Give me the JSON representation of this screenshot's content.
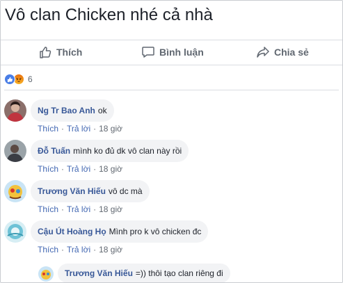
{
  "post": {
    "text": "Vô clan Chicken nhé cả nhà"
  },
  "actions": {
    "like": "Thích",
    "comment": "Bình luận",
    "share": "Chia sẻ"
  },
  "reactions": {
    "count": "6",
    "types": [
      "like-icon",
      "angry-icon"
    ]
  },
  "comments": [
    {
      "author": "Ng Tr Bao Anh",
      "text": "ok",
      "like": "Thích",
      "reply": "Trả lời",
      "time": "18 giờ"
    },
    {
      "author": "Đỗ Tuấn",
      "text": "mình ko đủ dk vô clan này rồi",
      "like": "Thích",
      "reply": "Trả lời",
      "time": "18 giờ"
    },
    {
      "author": "Trương Văn Hiếu",
      "text": "vô dc mà",
      "like": "Thích",
      "reply": "Trả lời",
      "time": "18 giờ"
    },
    {
      "author": "Cậu Út Hoàng Họ",
      "text": "Mình pro k vô chicken đc",
      "like": "Thích",
      "reply": "Trả lời",
      "time": "18 giờ"
    }
  ],
  "reply": {
    "author": "Trương Văn Hiếu",
    "text": "=)) thôi tạo clan riêng đi"
  },
  "colors": {
    "link": "#385898",
    "meta_link": "#4267b2",
    "bubble": "#f2f3f5",
    "muted": "#606770"
  }
}
